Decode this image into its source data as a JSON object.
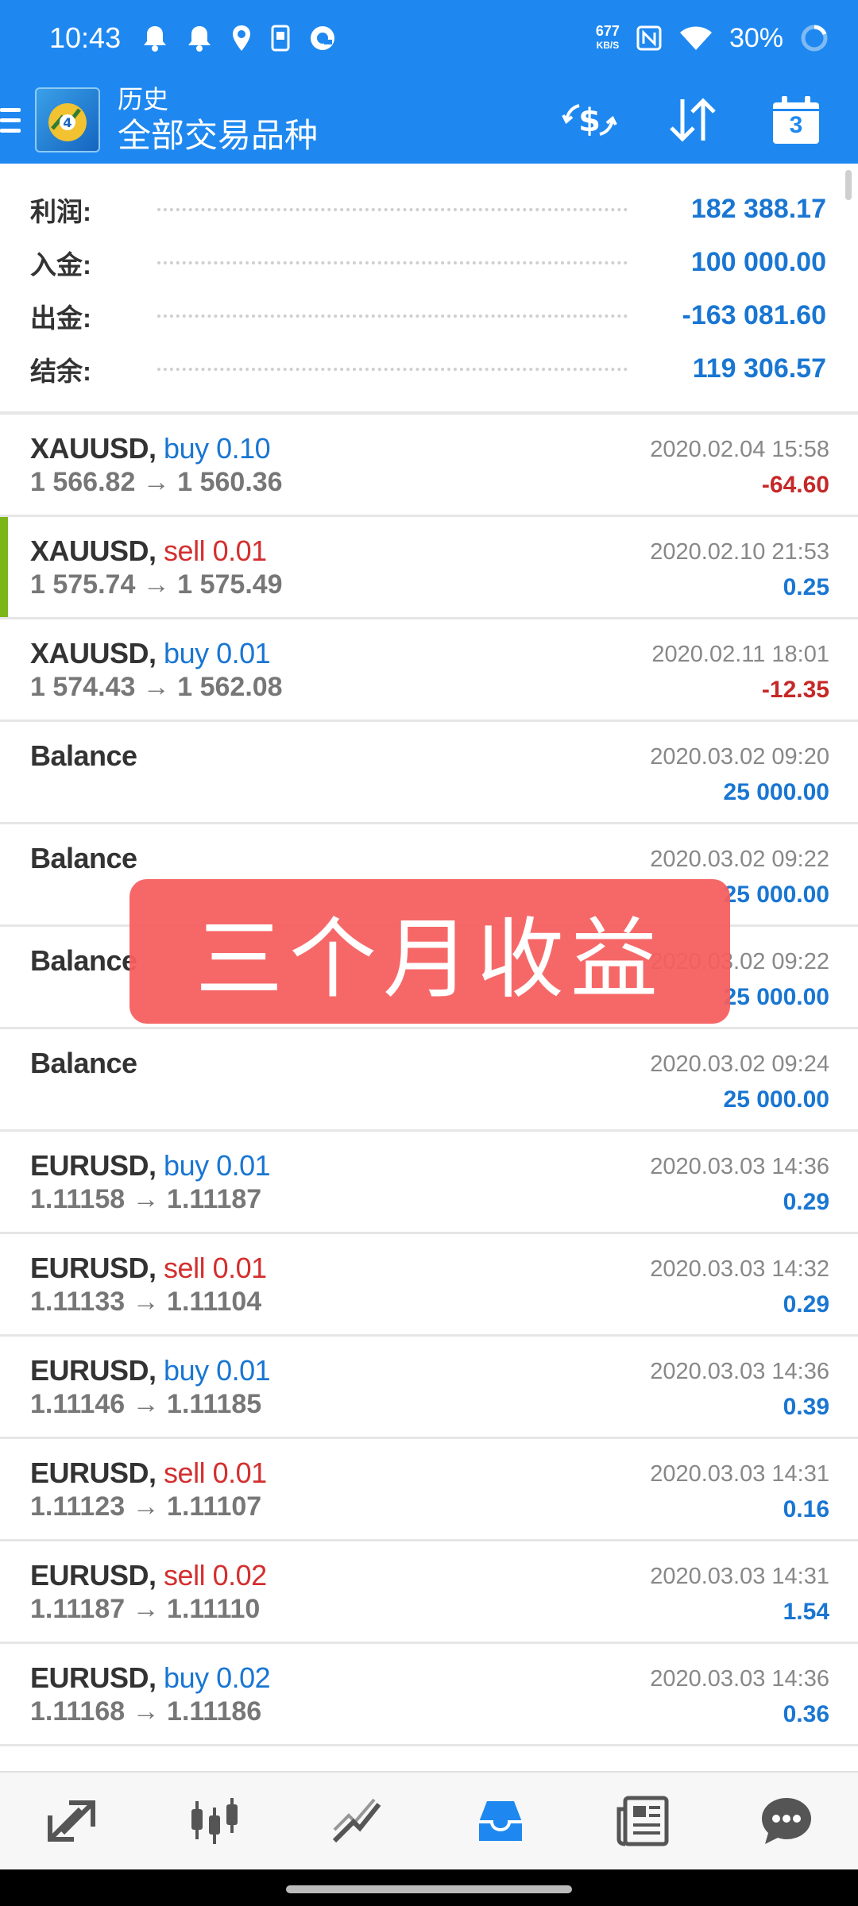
{
  "status_bar": {
    "time": "10:43",
    "net_speed": "677",
    "net_unit": "KB/S",
    "battery": "30%"
  },
  "header": {
    "subtitle": "历史",
    "title": "全部交易品种",
    "calendar_day": "3"
  },
  "summary": [
    {
      "label": "利润:",
      "value": "182 388.17"
    },
    {
      "label": "入金:",
      "value": "100 000.00"
    },
    {
      "label": "出金:",
      "value": "-163 081.60"
    },
    {
      "label": "结余:",
      "value": "119 306.57"
    }
  ],
  "trades": [
    {
      "symbol": "XAUUSD,",
      "side": "buy 0.10",
      "side_type": "buy",
      "prices": "1 566.82 → 1 560.36",
      "time": "2020.02.04 15:58",
      "profit": "-64.60",
      "profit_type": "neg"
    },
    {
      "symbol": "XAUUSD,",
      "side": "sell 0.01",
      "side_type": "sell",
      "prices": "1 575.74 → 1 575.49",
      "time": "2020.02.10 21:53",
      "profit": "0.25",
      "profit_type": "pos",
      "highlight": true
    },
    {
      "symbol": "XAUUSD,",
      "side": "buy 0.01",
      "side_type": "buy",
      "prices": "1 574.43 → 1 562.08",
      "time": "2020.02.11 18:01",
      "profit": "-12.35",
      "profit_type": "neg"
    },
    {
      "symbol": "Balance",
      "side": "",
      "side_type": "none",
      "prices": "",
      "time": "2020.03.02 09:20",
      "profit": "25 000.00",
      "profit_type": "pos"
    },
    {
      "symbol": "Balance",
      "side": "",
      "side_type": "none",
      "prices": "",
      "time": "2020.03.02 09:22",
      "profit": "25 000.00",
      "profit_type": "pos"
    },
    {
      "symbol": "Balance",
      "side": "",
      "side_type": "none",
      "prices": "",
      "time": "2020.03.02 09:22",
      "profit": "25 000.00",
      "profit_type": "pos"
    },
    {
      "symbol": "Balance",
      "side": "",
      "side_type": "none",
      "prices": "",
      "time": "2020.03.02 09:24",
      "profit": "25 000.00",
      "profit_type": "pos"
    },
    {
      "symbol": "EURUSD,",
      "side": "buy 0.01",
      "side_type": "buy",
      "prices": "1.11158 → 1.11187",
      "time": "2020.03.03 14:36",
      "profit": "0.29",
      "profit_type": "pos"
    },
    {
      "symbol": "EURUSD,",
      "side": "sell 0.01",
      "side_type": "sell",
      "prices": "1.11133 → 1.11104",
      "time": "2020.03.03 14:32",
      "profit": "0.29",
      "profit_type": "pos"
    },
    {
      "symbol": "EURUSD,",
      "side": "buy 0.01",
      "side_type": "buy",
      "prices": "1.11146 → 1.11185",
      "time": "2020.03.03 14:36",
      "profit": "0.39",
      "profit_type": "pos"
    },
    {
      "symbol": "EURUSD,",
      "side": "sell 0.01",
      "side_type": "sell",
      "prices": "1.11123 → 1.11107",
      "time": "2020.03.03 14:31",
      "profit": "0.16",
      "profit_type": "pos"
    },
    {
      "symbol": "EURUSD,",
      "side": "sell 0.02",
      "side_type": "sell",
      "prices": "1.11187 → 1.11110",
      "time": "2020.03.03 14:31",
      "profit": "1.54",
      "profit_type": "pos"
    },
    {
      "symbol": "EURUSD,",
      "side": "buy 0.02",
      "side_type": "buy",
      "prices": "1.11168 → 1.11186",
      "time": "2020.03.03 14:36",
      "profit": "0.36",
      "profit_type": "pos"
    }
  ],
  "overlay_text": "三个月收益",
  "colors": {
    "primary": "#1e88f0",
    "buy": "#1976d2",
    "sell": "#d32f2f",
    "highlight": "#7cb518",
    "banner": "#f55f5f"
  },
  "bottom_nav": [
    {
      "icon": "quotes-icon"
    },
    {
      "icon": "chart-icon"
    },
    {
      "icon": "trade-icon"
    },
    {
      "icon": "history-icon",
      "active": true
    },
    {
      "icon": "news-icon"
    },
    {
      "icon": "chat-icon"
    }
  ]
}
